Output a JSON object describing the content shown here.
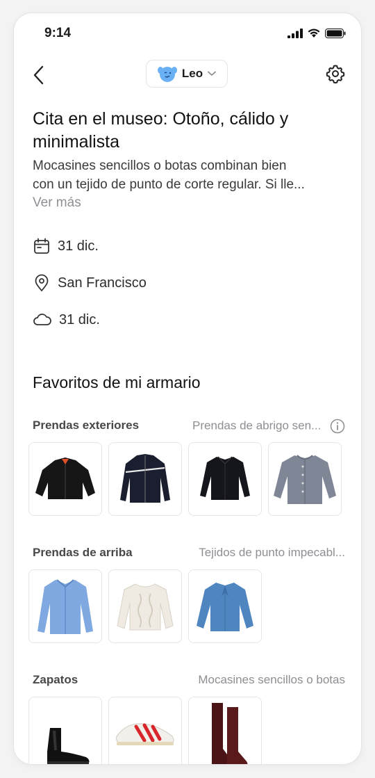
{
  "status_bar": {
    "time": "9:14"
  },
  "header": {
    "profile_name": "Leo"
  },
  "outfit": {
    "title": "Cita en el museo: Otoño, cálido y minimalista",
    "description_lines": [
      "Mocasines sencillos o botas combinan bien",
      "con un tejido de punto de corte regular. Si lle..."
    ],
    "see_more": "Ver más",
    "date": "31 dic.",
    "location": "San Francisco",
    "weather": "31 dic."
  },
  "wardrobe": {
    "title": "Favoritos de mi armario",
    "categories": [
      {
        "name": "Prendas exteriores",
        "note": "Prendas de abrigo sen...",
        "items": [
          "black-bomber-jacket",
          "black-track-jacket",
          "black-shirt-jacket",
          "grey-knit-cardigan"
        ]
      },
      {
        "name": "Prendas de arriba",
        "note": "Tejidos de punto impecabl...",
        "items": [
          "blue-oversized-shirt",
          "cream-cable-knit-sweater",
          "blue-tie-neck-blouse"
        ]
      },
      {
        "name": "Zapatos",
        "note": "Mocasines sencillos o botas",
        "items": [
          "black-chelsea-boots",
          "red-white-running-sneakers",
          "burgundy-knee-high-boots"
        ]
      }
    ]
  },
  "colors": {
    "accent_avatar": "#6ab0f5",
    "muted_text": "#8e8e93"
  }
}
